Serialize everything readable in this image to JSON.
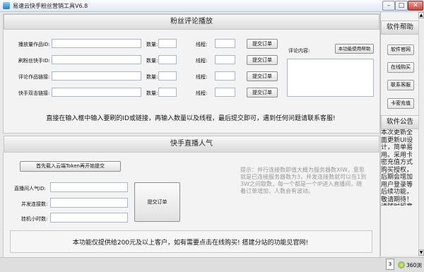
{
  "window": {
    "title": "易速云快手粉丝营销工具V6.8"
  },
  "comment_section": {
    "header": "粉丝评论播放",
    "rows": [
      {
        "label": "播放量作品ID:",
        "qty_label": "数量:",
        "thread_label": "线程:",
        "button": "提交订单"
      },
      {
        "label": "刷粉丝快手ID:",
        "qty_label": "数量:",
        "thread_label": "线程:",
        "button": "提交订单"
      },
      {
        "label": "评论作品链接:",
        "qty_label": "数量:",
        "thread_label": "线程:",
        "button": "提交订单"
      },
      {
        "label": "快手双击链接:",
        "qty_label": "数量:",
        "thread_label": "线程:",
        "button": "提交订单"
      }
    ],
    "comment_label": "评论内容:",
    "help_button": "本功能使用帮助",
    "notice": "直接在输入框中输入要刷的ID或链接，再输入数量以及线程，最后提交即可，遇到任何问题请联系客服!"
  },
  "live_section": {
    "header": "快手直播人气",
    "load_token_button": "首先载入云端Token再开始提交",
    "fields": [
      {
        "label": "直播间人气ID:"
      },
      {
        "label": "并发连接数:"
      },
      {
        "label": "挂机小时数:"
      }
    ],
    "submit_button": "提交订单",
    "hint": "提示：并行连接数即值大概为服务器数XIW，意思就是已连接服务器数为3，并发连接数就可以在1到3W之间取数，每一个都是一个IP进入直播间，随着订单增加，人数会有波动。",
    "notice": "本功能仅提供给200元及以上客户，如有需要点击在线购买! 搭建分站的功能见官网!"
  },
  "sidebar": {
    "help_header": "软件帮助",
    "buttons": [
      "软件官网",
      "在线购买",
      "联系客服",
      "卡密充值"
    ],
    "announce_header": "软件公告",
    "announcement": "本次更新全面更新UI设计，简单易用。采用卡密充值方式购买授权，后期会增加用户登录等后续功能，敬请期待！请随时留意官网的更新，如有问题联系客服！"
  },
  "statusbar": {
    "badge": "3",
    "brand": "360浏"
  }
}
